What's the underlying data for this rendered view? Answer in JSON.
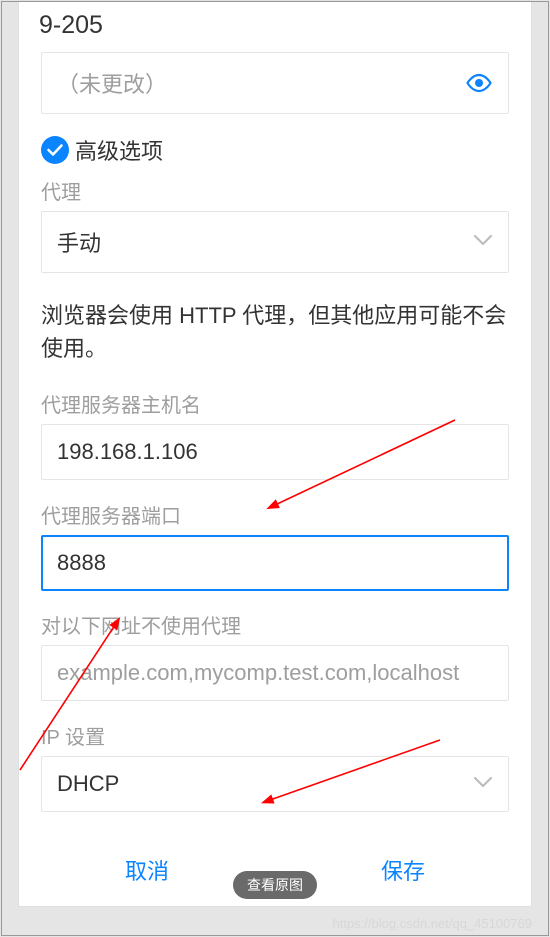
{
  "dialog": {
    "title": "9-205",
    "password_display": "（未更改）",
    "advanced_label": "高级选项",
    "proxy": {
      "label": "代理",
      "value": "手动"
    },
    "info": "浏览器会使用 HTTP 代理，但其他应用可能不会使用。",
    "host": {
      "label": "代理服务器主机名",
      "value": "198.168.1.106"
    },
    "port": {
      "label": "代理服务器端口",
      "value": "8888"
    },
    "bypass": {
      "label": "对以下网址不使用代理",
      "placeholder": "example.com,mycomp.test.com,localhost"
    },
    "ip": {
      "label": "IP 设置",
      "value": "DHCP"
    },
    "cancel": "取消",
    "save": "保存"
  },
  "overlay_button": "查看原图",
  "watermark": "https://blog.csdn.net/qq_45100769"
}
